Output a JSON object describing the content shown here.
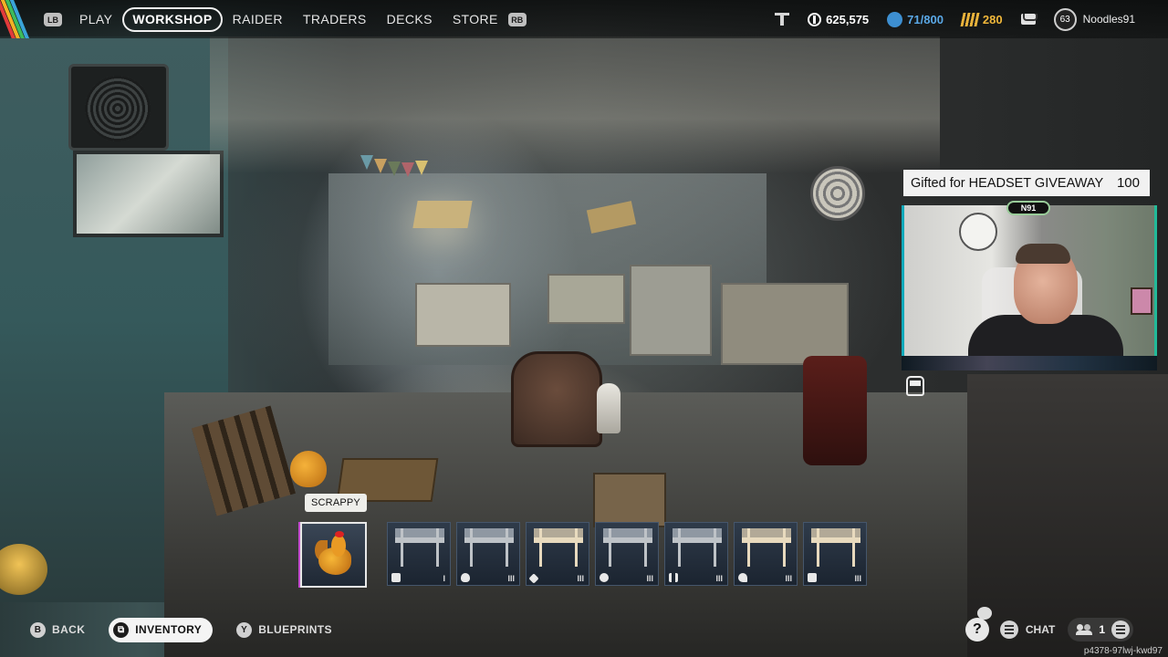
{
  "topbar": {
    "lb_badge": "LB",
    "rb_badge": "RB",
    "nav": [
      {
        "label": "PLAY"
      },
      {
        "label": "WORKSHOP",
        "active": true
      },
      {
        "label": "RAIDER"
      },
      {
        "label": "TRADERS"
      },
      {
        "label": "DECKS"
      },
      {
        "label": "STORE"
      }
    ],
    "coins": "625,575",
    "capacity": "71/800",
    "gold": "280",
    "player_level": "63",
    "username": "Noodles91"
  },
  "stream": {
    "gift_text": "Gifted for HEADSET GIVEAWAY",
    "gift_amount": "100",
    "cam_tag": "N91"
  },
  "items": {
    "tooltip": "SCRAPPY",
    "slots": [
      {
        "name": "Scrappy",
        "tier": ""
      },
      {
        "name": "workbench-1",
        "tier": "I"
      },
      {
        "name": "workbench-2",
        "tier": "III"
      },
      {
        "name": "workbench-3",
        "tier": "III"
      },
      {
        "name": "workbench-4",
        "tier": "III"
      },
      {
        "name": "workbench-5",
        "tier": "III"
      },
      {
        "name": "workbench-6",
        "tier": "III"
      },
      {
        "name": "workbench-7",
        "tier": "III"
      }
    ]
  },
  "bottom": {
    "back_key": "B",
    "back_label": "BACK",
    "inventory_label": "INVENTORY",
    "blueprints_key": "Y",
    "blueprints_label": "BLUEPRINTS",
    "help": "?",
    "chat_label": "CHAT",
    "party_count": "1",
    "session_id": "p4378-97lwj-kwd97"
  },
  "colors": {
    "accent_blue": "#3d8fd1",
    "gold": "#e8b23b",
    "slot_bg": "#2f3b4a"
  }
}
